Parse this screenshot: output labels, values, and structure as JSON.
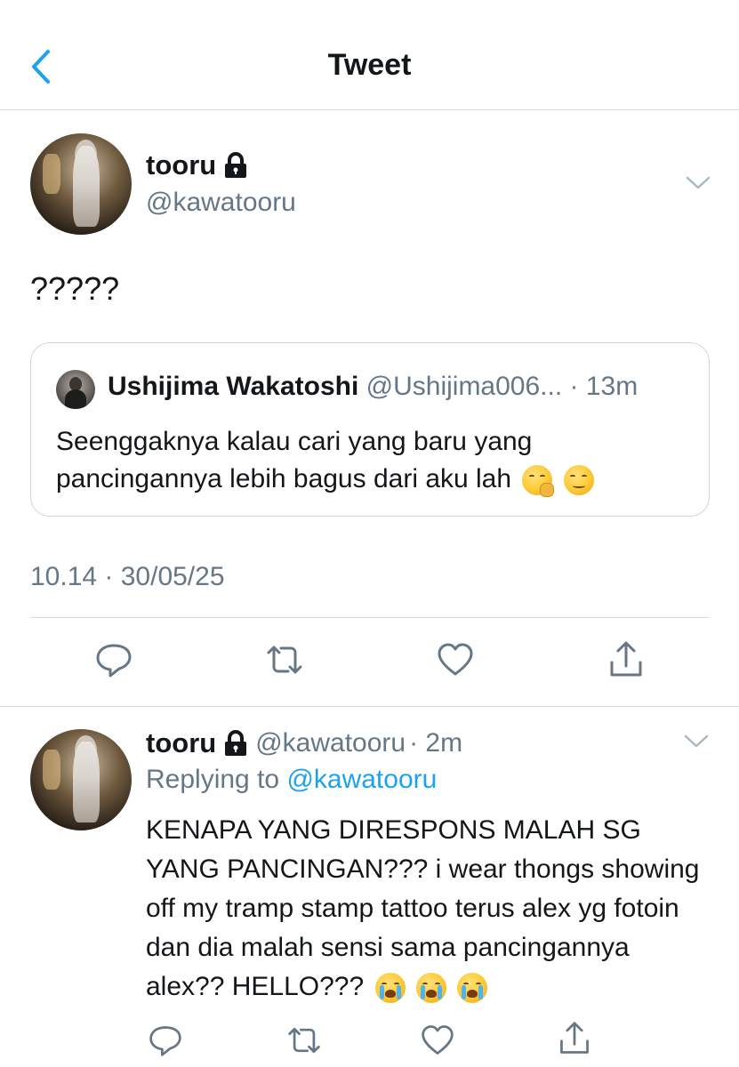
{
  "header": {
    "title": "Tweet",
    "back_icon": "chevron-left-icon"
  },
  "tweet": {
    "author_name": "tooru",
    "author_handle": "@kawatooru",
    "protected_icon": "lock-icon",
    "text": "?????",
    "timestamp": "10.14 · 30/05/25",
    "quote": {
      "author_name": "Ushijima Wakatoshi",
      "author_handle": "@Ushijima006...",
      "time": "· 13m",
      "text": "Seenggaknya kalau cari yang baru yang pancingannya lebih bagus dari aku lah",
      "emojis": [
        "hand-over-mouth-emoji",
        "relieved-face-emoji"
      ]
    }
  },
  "reply": {
    "author_name": "tooru",
    "author_handle": "@kawatooru",
    "time": "· 2m",
    "replying_prefix": "Replying to",
    "replying_handle": "@kawatooru",
    "text": "KENAPA YANG DIRESPONS MALAH SG YANG PANCINGAN??? i wear thongs showing off my tramp stamp tattoo terus alex yg fotoin dan dia malah sensi sama pancingannya alex?? HELLO???",
    "emojis": [
      "loudly-crying-emoji",
      "loudly-crying-emoji",
      "loudly-crying-emoji"
    ]
  },
  "colors": {
    "accent": "#1da1f2",
    "secondary_text": "#657786",
    "border": "#d6d9dc"
  }
}
